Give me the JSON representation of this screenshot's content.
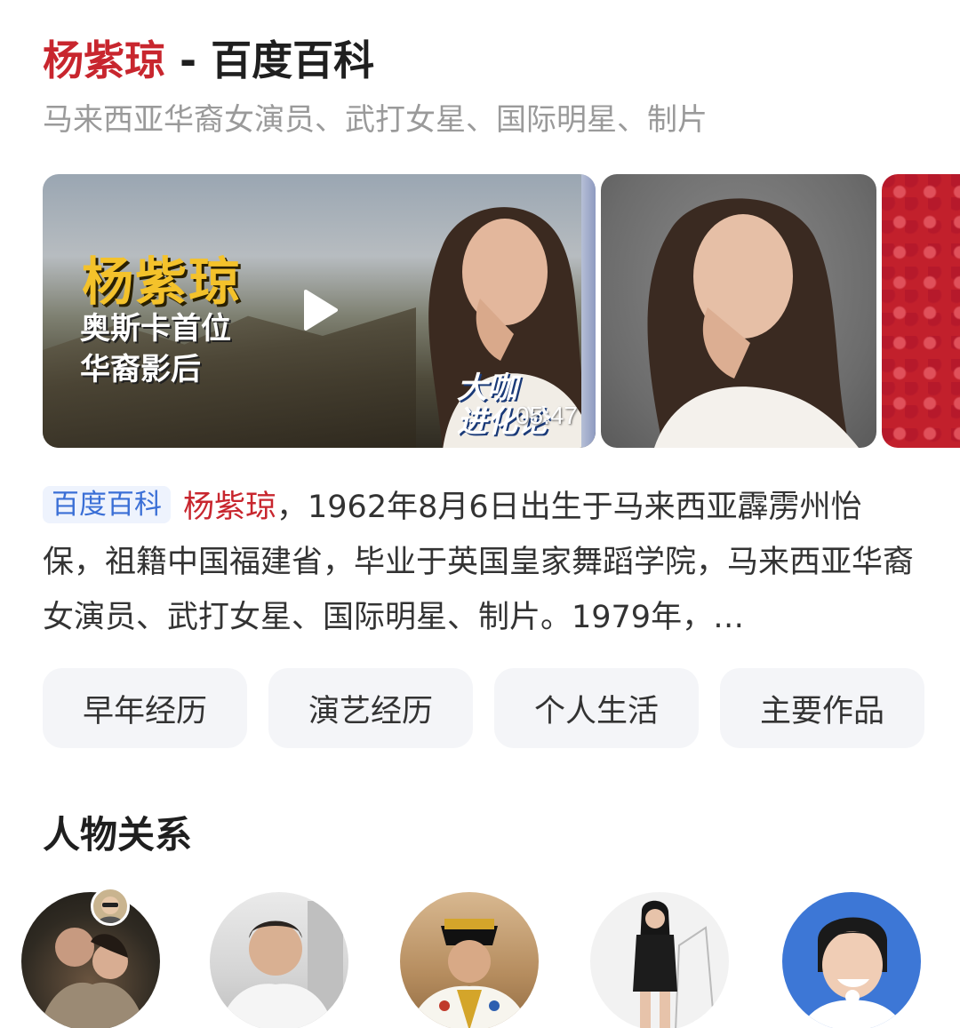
{
  "header": {
    "entity_name": "杨紫琼",
    "title_suffix": " - 百度百科",
    "subtitle": "马来西亚华裔女演员、武打女星、国际明星、制片"
  },
  "media": {
    "video": {
      "overlay_title": "杨紫琼",
      "overlay_line_1": "奥斯卡首位",
      "overlay_line_2": "华裔影后",
      "brand_line_1": "大咖",
      "brand_line_2": "进化论",
      "duration": "05:47"
    }
  },
  "summary": {
    "source_badge": "百度百科",
    "entity_name": "杨紫琼",
    "text": "，1962年8月6日出生于马来西亚霹雳州怡保，祖籍中国福建省，毕业于英国皇家舞蹈学院，马来西亚华裔女演员、武打女星、国际明星、制片。1979年，…"
  },
  "tabs": [
    {
      "label": "早年经历"
    },
    {
      "label": "演艺经历"
    },
    {
      "label": "个人生活"
    },
    {
      "label": "主要作品"
    }
  ],
  "relations": {
    "title": "人物关系",
    "avatars": [
      "avatar-1",
      "avatar-2",
      "avatar-3",
      "avatar-4",
      "avatar-5"
    ]
  },
  "colors": {
    "accent_red": "#c8262e",
    "badge_blue": "#3a6fd6",
    "tab_bg": "#f4f5f8"
  }
}
